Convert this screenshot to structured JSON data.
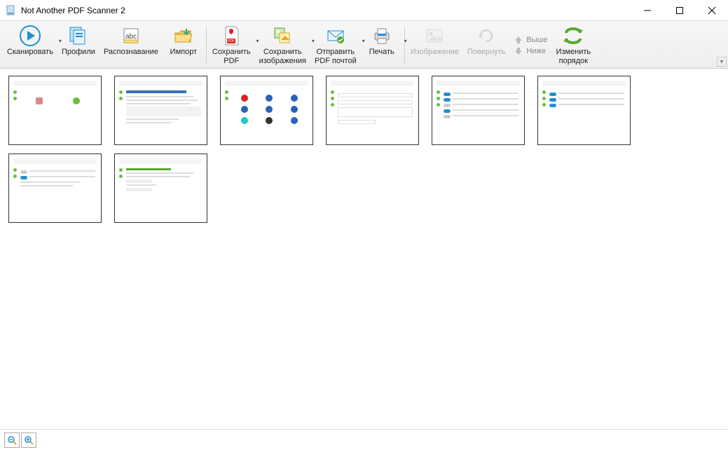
{
  "window": {
    "title": "Not Another PDF Scanner 2"
  },
  "toolbar": {
    "scan": "Сканировать",
    "profiles": "Профили",
    "ocr": "Распознавание",
    "import": "Импорт",
    "save_pdf_l1": "Сохранить",
    "save_pdf_l2": "PDF",
    "save_images_l1": "Сохранить",
    "save_images_l2": "изображения",
    "send_pdf_l1": "Отправить",
    "send_pdf_l2": "PDF почтой",
    "print": "Печать",
    "image": "Изображение",
    "rotate": "Повернуть",
    "move_up": "Выше",
    "move_down": "Ниже",
    "reorder_l1": "Изменить",
    "reorder_l2": "порядок"
  },
  "thumbnails": {
    "count": 8
  },
  "status": {
    "zoom_out": "Zoom out",
    "zoom_in": "Zoom in"
  },
  "colors": {
    "accent_blue": "#1e90d2",
    "green": "#5aa62e",
    "orange": "#e6a330",
    "red": "#d22",
    "disabled": "#aaaaaa"
  }
}
